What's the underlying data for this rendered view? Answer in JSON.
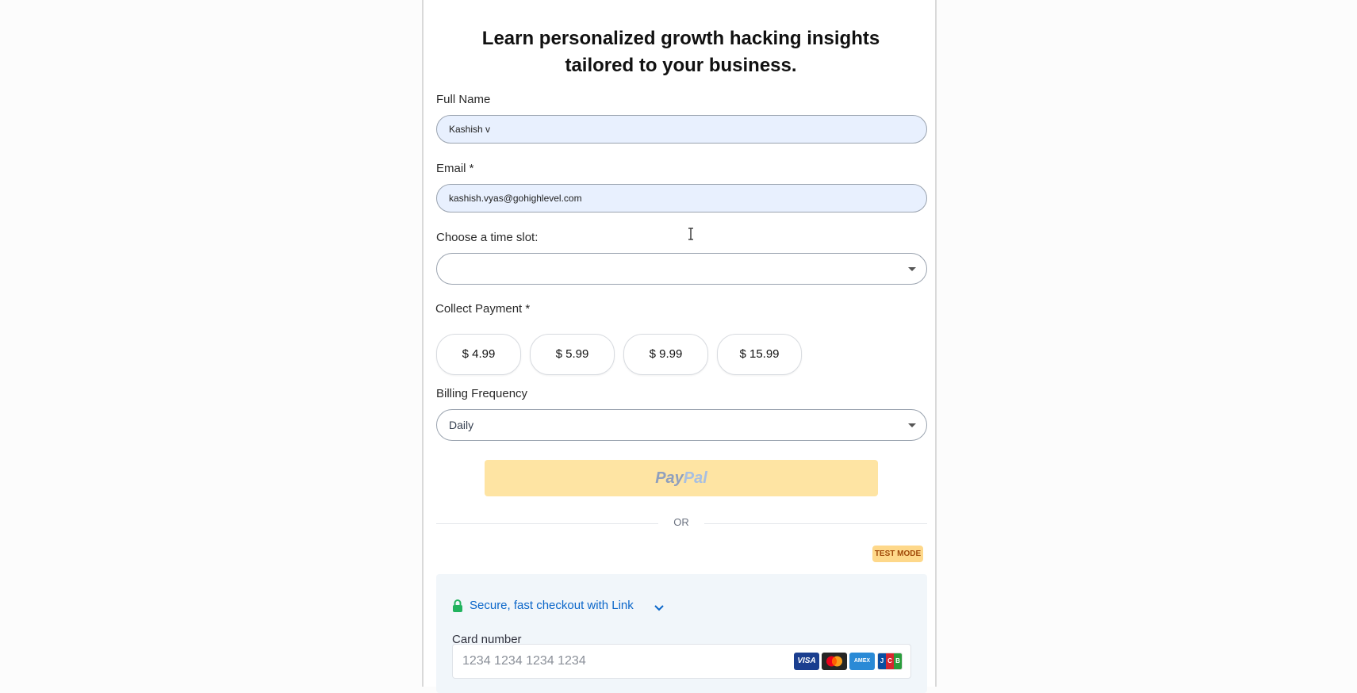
{
  "form": {
    "headline": "Learn personalized growth hacking insights tailored to your business.",
    "full_name_label": "Full Name",
    "full_name_value": "Kashish v",
    "email_label": "Email *",
    "email_value": "kashish.vyas@gohighlevel.com",
    "time_slot_label": "Choose a time slot:",
    "time_slot_value": "",
    "payment_label": "Collect Payment *",
    "prices": [
      "$ 4.99",
      "$ 5.99",
      "$ 9.99",
      "$ 15.99"
    ],
    "billing_label": "Billing Frequency",
    "billing_value": "Daily",
    "paypal_pay": "Pay",
    "paypal_pal": "Pal",
    "or_text": "OR",
    "test_mode": "TEST MODE"
  },
  "stripe": {
    "link_text": "Secure, fast checkout with Link",
    "card_number_label": "Card number",
    "card_number_placeholder": "1234 1234 1234 1234",
    "brands": [
      "VISA",
      "mastercard",
      "AMEX",
      "JCB"
    ]
  },
  "colors": {
    "input_autofill_bg": "#e8f0fe",
    "paypal_yellow": "#fee4a3",
    "link_blue": "#0a66c9",
    "lock_green": "#22b35e",
    "test_mode_bg": "#fed88a"
  }
}
